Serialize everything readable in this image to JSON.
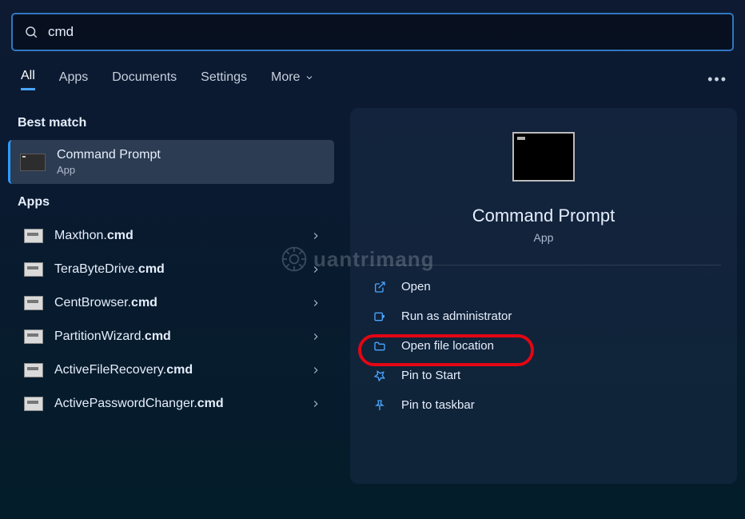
{
  "search": {
    "value": "cmd"
  },
  "tabs": {
    "all": "All",
    "apps": "Apps",
    "documents": "Documents",
    "settings": "Settings",
    "more": "More"
  },
  "sections": {
    "best_match": "Best match",
    "apps": "Apps"
  },
  "best_match": {
    "title": "Command Prompt",
    "subtitle": "App"
  },
  "apps_list": [
    {
      "prefix": "Maxthon.",
      "suffix": "cmd"
    },
    {
      "prefix": "TeraByteDrive.",
      "suffix": "cmd"
    },
    {
      "prefix": "CentBrowser.",
      "suffix": "cmd"
    },
    {
      "prefix": "PartitionWizard.",
      "suffix": "cmd"
    },
    {
      "prefix": "ActiveFileRecovery.",
      "suffix": "cmd"
    },
    {
      "prefix": "ActivePasswordChanger.",
      "suffix": "cmd"
    }
  ],
  "preview": {
    "title": "Command Prompt",
    "subtitle": "App"
  },
  "actions": {
    "open": "Open",
    "run_admin": "Run as administrator",
    "open_location": "Open file location",
    "pin_start": "Pin to Start",
    "pin_taskbar": "Pin to taskbar"
  },
  "watermark": "uantrimang"
}
